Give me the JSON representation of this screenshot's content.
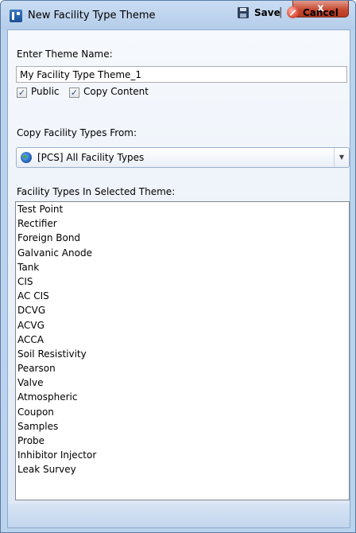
{
  "window": {
    "title": "New Facility Type Theme",
    "close_glyph": "x"
  },
  "form": {
    "theme_name_label": "Enter Theme Name:",
    "theme_name_value": "My Facility Type Theme_1",
    "public_label": "Public",
    "public_checked": true,
    "copy_content_label": "Copy Content",
    "copy_content_checked": true,
    "copy_from_label": "Copy Facility Types From:",
    "copy_from_selected": "[PCS] All Facility Types",
    "list_label": "Facility Types In Selected Theme:",
    "facility_types": [
      "Test Point",
      "Rectifier",
      "Foreign Bond",
      "Galvanic Anode",
      "Tank",
      "CIS",
      "AC CIS",
      "DCVG",
      "ACVG",
      "ACCA",
      "Soil Resistivity",
      "Pearson",
      "Valve",
      "Atmospheric",
      "Coupon",
      "Samples",
      "Probe",
      "Inhibitor Injector",
      "Leak Survey"
    ]
  },
  "footer": {
    "save_label": "Save",
    "separator": "|",
    "cancel_label": "Cancel"
  },
  "icons": {
    "app": "facility-app-icon",
    "save": "floppy-disk-icon",
    "cancel": "cancel-icon",
    "globe": "globe-icon",
    "dropdown": "chevron-down-icon"
  },
  "colors": {
    "titlebar": "#b5cdea",
    "close_button": "#c74a32",
    "frame": "#bcd3ee"
  }
}
